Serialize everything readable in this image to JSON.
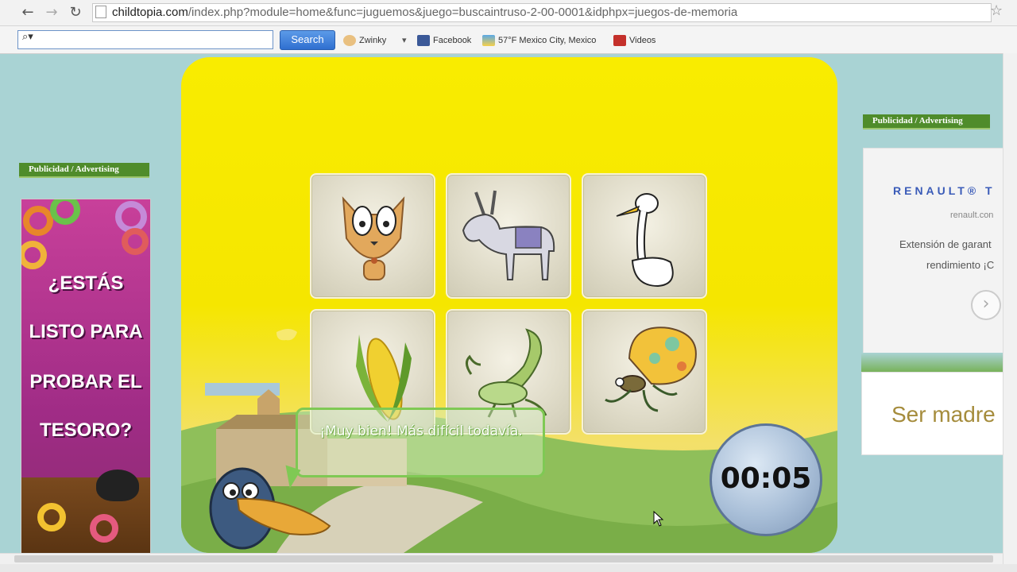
{
  "browser": {
    "url_host": "childtopia.com",
    "url_path": "/index.php?module=home&func=juguemos&juego=buscaintruso-2-00-0001&idphpx=juegos-de-memoria"
  },
  "toolbar": {
    "search_button": "Search",
    "items": [
      "Zwinky",
      "Facebook",
      "57°F Mexico City, Mexico",
      "Videos"
    ]
  },
  "ads": {
    "label": "Publicidad / Advertising",
    "left_ad_lines": [
      "¿ESTÁS",
      "LISTO PARA",
      "PROBAR EL",
      "TESORO?"
    ],
    "renault_title": "RENAULT® T",
    "renault_url": "renault.con",
    "renault_line1": "Extensión de garant",
    "renault_line2": "rendimiento ¡C",
    "second_ad_text": "Ser madre"
  },
  "game": {
    "tiles": [
      "cat",
      "donkey",
      "goose",
      "corn",
      "scorpion",
      "butterfly"
    ],
    "message": "¡Muy bien! Más difícil todavía.",
    "timer": "00:05"
  }
}
